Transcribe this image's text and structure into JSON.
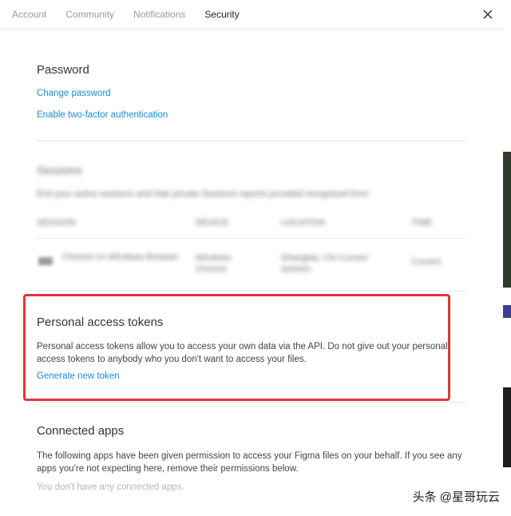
{
  "tabs": [
    {
      "label": "Account",
      "active": false
    },
    {
      "label": "Community",
      "active": false
    },
    {
      "label": "Notifications",
      "active": false
    },
    {
      "label": "Security",
      "active": true
    }
  ],
  "password": {
    "heading": "Password",
    "change_link": "Change password",
    "twofa_link": "Enable two-factor authentication"
  },
  "sessions_blurred": {
    "heading": "Sessions",
    "description": "End your active sessions and hide private Sessions reports provided recognized from.",
    "headers": [
      "SESSION",
      "DEVICE",
      "LOCATION",
      "TIME"
    ],
    "row": [
      "Chrome on Windows Browser",
      "Windows Chrome",
      "Shanghai, CN Current session",
      "Current"
    ]
  },
  "tokens": {
    "heading": "Personal access tokens",
    "description": "Personal access tokens allow you to access your own data via the API. Do not give out your personal access tokens to anybody who you don't want to access your files.",
    "generate_link": "Generate new token"
  },
  "connected_apps": {
    "heading": "Connected apps",
    "description": "The following apps have been given permission to access your Figma files on your behalf. If you see any apps you're not expecting here, remove their permissions below.",
    "empty": "You don't have any connected apps."
  },
  "colors": {
    "link": "#1a8cd8",
    "highlight": "#e0353a"
  },
  "watermark": "头条 @星哥玩云"
}
